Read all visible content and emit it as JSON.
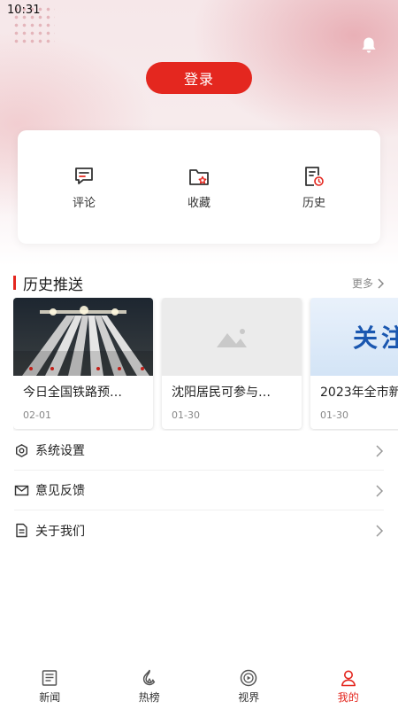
{
  "status_bar": {
    "time": "10:31"
  },
  "header": {
    "login_label": "登录",
    "bell_icon": "bell-icon"
  },
  "quick_actions": [
    {
      "label": "评论",
      "icon": "comment-icon"
    },
    {
      "label": "收藏",
      "icon": "favorite-folder-icon"
    },
    {
      "label": "历史",
      "icon": "history-icon"
    }
  ],
  "history_section": {
    "title": "历史推送",
    "more_label": "更多",
    "cards": [
      {
        "title": "今日全国铁路预…",
        "date": "02-01",
        "thumb": "railway-photo"
      },
      {
        "title": "沈阳居民可参与…",
        "date": "01-30",
        "thumb": "placeholder-image-icon"
      },
      {
        "title": "2023年全市新",
        "date": "01-30",
        "thumb": "banner-image",
        "thumb_text": "关注"
      }
    ]
  },
  "menu": [
    {
      "label": "系统设置",
      "icon": "settings-icon"
    },
    {
      "label": "意见反馈",
      "icon": "mail-icon"
    },
    {
      "label": "关于我们",
      "icon": "document-icon"
    }
  ],
  "bottom_nav": [
    {
      "label": "新闻",
      "icon": "news-icon",
      "active": false
    },
    {
      "label": "热榜",
      "icon": "flame-icon",
      "active": false
    },
    {
      "label": "视界",
      "icon": "video-icon",
      "active": false
    },
    {
      "label": "我的",
      "icon": "user-icon",
      "active": true
    }
  ],
  "colors": {
    "accent": "#e4271f",
    "text": "#222222",
    "muted": "#888888"
  }
}
